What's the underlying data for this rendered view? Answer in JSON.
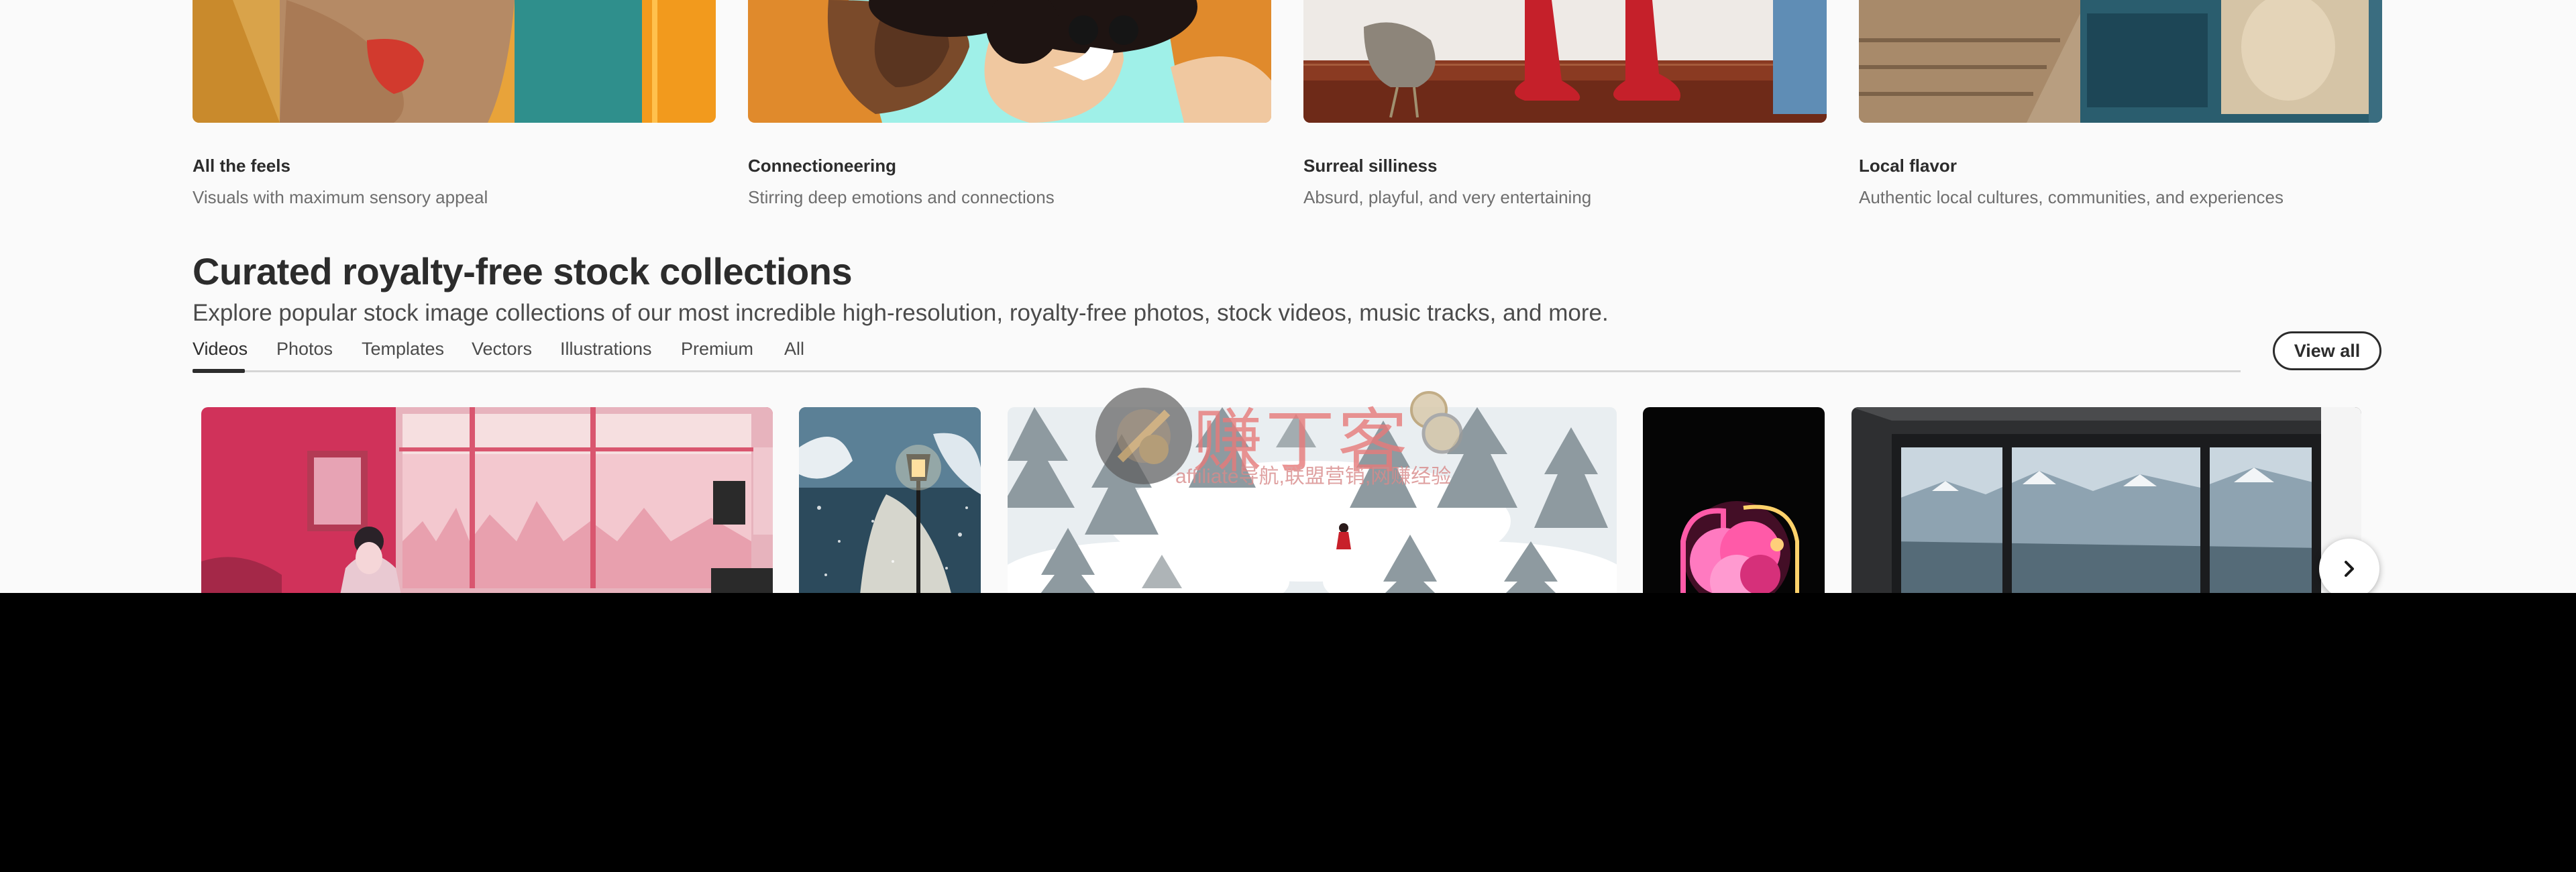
{
  "feature_cards": [
    {
      "title": "All the feels",
      "description": "Visuals with maximum sensory appeal"
    },
    {
      "title": "Connectioneering",
      "description": "Stirring deep emotions and connections"
    },
    {
      "title": "Surreal silliness",
      "description": "Absurd, playful, and very entertaining"
    },
    {
      "title": "Local flavor",
      "description": "Authentic local cultures, communities, and experiences"
    }
  ],
  "collections": {
    "heading": "Curated royalty-free stock collections",
    "subheading": "Explore popular stock image collections of our most incredible high-resolution, royalty-free photos, stock videos, music tracks, and more.",
    "tabs": [
      "Videos",
      "Photos",
      "Templates",
      "Vectors",
      "Illustrations",
      "Premium",
      "All"
    ],
    "active_tab": "Videos",
    "view_all_label": "View all"
  },
  "watermark": {
    "logo_text": "赚丁客",
    "tagline": "affiliate导航,联盟营销,网赚经验"
  },
  "icons": {
    "next": "chevron-right-icon"
  },
  "colors": {
    "text": "#2c2c2c",
    "muted": "#6e6e6e",
    "background": "#fafafa"
  }
}
